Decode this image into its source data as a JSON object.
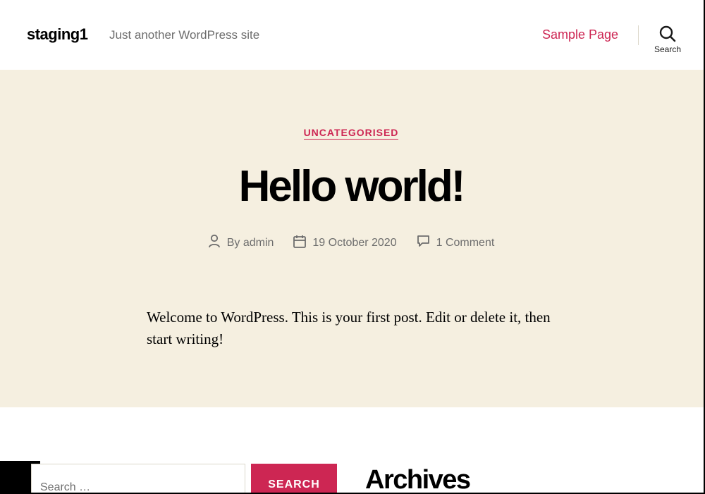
{
  "header": {
    "site_title": "staging1",
    "site_description": "Just another WordPress site",
    "nav_link": "Sample Page",
    "search_label": "Search"
  },
  "entry": {
    "category": "UNCATEGORISED",
    "title": "Hello world!",
    "meta": {
      "author_prefix": "By",
      "author": "admin",
      "date": "19 October 2020",
      "comments": "1 Comment"
    },
    "content": "Welcome to WordPress. This is your first post. Edit or delete it, then start writing!"
  },
  "footer": {
    "search_placeholder": "Search …",
    "search_button": "SEARCH",
    "archives_title": "Archives"
  },
  "colors": {
    "accent": "#cd2653",
    "hero_background": "#f5efe0",
    "meta_text": "#6d6d6d"
  },
  "icons": [
    "search-icon",
    "user-icon",
    "calendar-icon",
    "comment-icon"
  ]
}
